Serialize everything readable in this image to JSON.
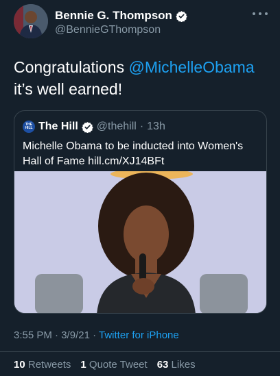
{
  "author": {
    "name": "Bennie G. Thompson",
    "handle": "@BennieGThompson",
    "icons": {
      "verified": "verified-badge-icon",
      "more": "more-options-icon"
    }
  },
  "tweet": {
    "text_before": "Congratulations ",
    "mention": "@MichelleObama",
    "text_after": " it’s well earned!"
  },
  "quote": {
    "logo_text": "THE HILL",
    "name": "The Hill",
    "handle": "@thehill",
    "separator": "·",
    "time": "13h",
    "text": "Michelle Obama to be inducted into Women's Hall of Fame hill.cm/XJ14BFt"
  },
  "meta": {
    "time": "3:55 PM",
    "separator": "·",
    "date": "3/9/21",
    "source": "Twitter for iPhone"
  },
  "stats": {
    "retweets_count": "10",
    "retweets_label": "Retweets",
    "quotes_count": "1",
    "quotes_label": "Quote Tweet",
    "likes_count": "63",
    "likes_label": "Likes"
  },
  "colors": {
    "background": "#15202b",
    "accent": "#1da1f2",
    "secondary_text": "#8899a6",
    "border": "#38444d"
  }
}
